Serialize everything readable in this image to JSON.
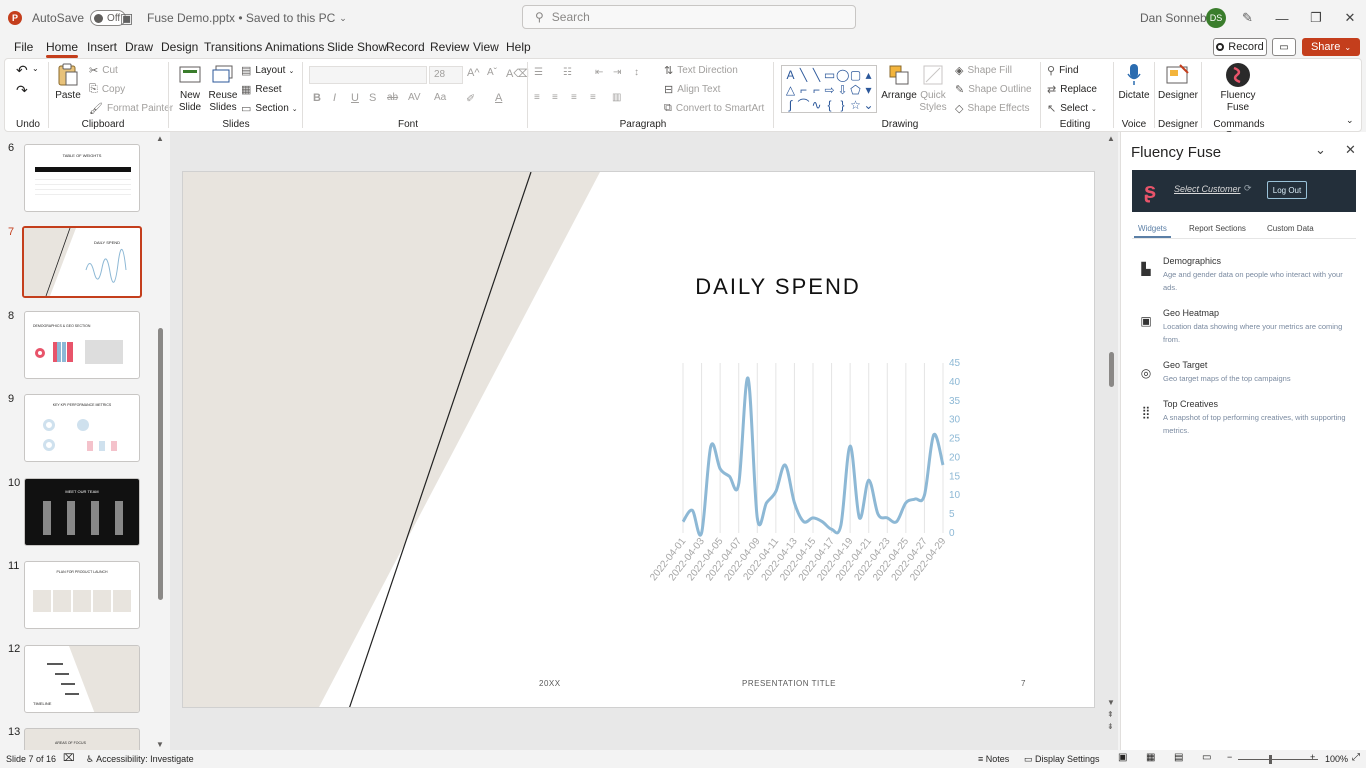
{
  "titlebar": {
    "autosave_label": "AutoSave",
    "autosave_state": "Off",
    "doc_name": "Fuse Demo.pptx • Saved to this PC",
    "search_placeholder": "Search",
    "user_name": "Dan Sonneborn",
    "user_initials": "DS",
    "app_icon": "P"
  },
  "menu": {
    "tabs": [
      "File",
      "Home",
      "Insert",
      "Draw",
      "Design",
      "Transitions",
      "Animations",
      "Slide Show",
      "Record",
      "Review",
      "View",
      "Help"
    ],
    "active_tab": "Home",
    "record_label": "Record",
    "share_label": "Share"
  },
  "ribbon": {
    "groups": [
      "Undo",
      "Clipboard",
      "Slides",
      "Font",
      "Paragraph",
      "Drawing",
      "Editing",
      "Voice",
      "Designer",
      "Commands Group"
    ],
    "clipboard": {
      "paste": "Paste",
      "cut": "Cut",
      "copy": "Copy",
      "format_painter": "Format Painter"
    },
    "slides": {
      "new_slide": "New Slide",
      "reuse_slides": "Reuse Slides",
      "layout": "Layout",
      "reset": "Reset",
      "section": "Section"
    },
    "font": {
      "size": "28"
    },
    "paragraph": {
      "text_direction": "Text Direction",
      "align_text": "Align Text",
      "convert_smartart": "Convert to SmartArt"
    },
    "drawing": {
      "arrange": "Arrange",
      "quick_styles": "Quick Styles",
      "shape_fill": "Shape Fill",
      "shape_outline": "Shape Outline",
      "shape_effects": "Shape Effects"
    },
    "editing": {
      "find": "Find",
      "replace": "Replace",
      "select": "Select"
    },
    "voice": {
      "dictate": "Dictate"
    },
    "designer": {
      "designer": "Designer"
    },
    "commands": {
      "fluency_fuse": "Fluency Fuse"
    }
  },
  "thumbnails": [
    {
      "num": "6",
      "title": "TABLE OF WEIGHTS"
    },
    {
      "num": "7",
      "title": "DAILY SPEND"
    },
    {
      "num": "8",
      "title": "DEMOGRAPHICS & GEO SECTION"
    },
    {
      "num": "9",
      "title": "KEY KPI PERFORMANCE METRICS"
    },
    {
      "num": "10",
      "title": "MEET OUR TEAM"
    },
    {
      "num": "11",
      "title": "PLAN FOR PRODUCT LAUNCH"
    },
    {
      "num": "12",
      "title": "TIMELINE"
    },
    {
      "num": "13",
      "title": "AREAS OF FOCUS"
    }
  ],
  "active_slide": "7",
  "slide": {
    "title": "DAILY SPEND",
    "footer_left": "20XX",
    "footer_center": "PRESENTATION TITLE",
    "footer_right": "7"
  },
  "chart_data": {
    "type": "line",
    "title": "",
    "xlabel": "",
    "ylabel": "",
    "ylim": [
      0,
      45
    ],
    "yticks": [
      0,
      5,
      10,
      15,
      20,
      25,
      30,
      35,
      40,
      45
    ],
    "y_axis_side": "right",
    "grid": "vertical",
    "x_tick_labels": [
      "2022-04-01",
      "2022-04-03",
      "2022-04-05",
      "2022-04-07",
      "2022-04-09",
      "2022-04-11",
      "2022-04-13",
      "2022-04-15",
      "2022-04-17",
      "2022-04-19",
      "2022-04-21",
      "2022-04-23",
      "2022-04-25",
      "2022-04-27",
      "2022-04-29"
    ],
    "x": [
      "2022-04-01",
      "2022-04-02",
      "2022-04-03",
      "2022-04-04",
      "2022-04-05",
      "2022-04-06",
      "2022-04-07",
      "2022-04-08",
      "2022-04-09",
      "2022-04-10",
      "2022-04-11",
      "2022-04-12",
      "2022-04-13",
      "2022-04-14",
      "2022-04-15",
      "2022-04-16",
      "2022-04-17",
      "2022-04-18",
      "2022-04-19",
      "2022-04-20",
      "2022-04-21",
      "2022-04-22",
      "2022-04-23",
      "2022-04-24",
      "2022-04-25",
      "2022-04-26",
      "2022-04-27",
      "2022-04-28",
      "2022-04-29"
    ],
    "series": [
      {
        "values": [
          3,
          6,
          0,
          23,
          17,
          15,
          13,
          41,
          4,
          8,
          11,
          18,
          8,
          3,
          4,
          3,
          1,
          2,
          23,
          4,
          14,
          5,
          4,
          3,
          8,
          9,
          10,
          26,
          18
        ],
        "color": "#8db8d5"
      }
    ]
  },
  "pane": {
    "title": "Fluency Fuse",
    "select_customer": "Select Customer",
    "logout": "Log Out",
    "tabs": [
      "Widgets",
      "Report Sections",
      "Custom Data"
    ],
    "widgets": [
      {
        "name": "Demographics",
        "desc": "Age and gender data on people who interact with your ads.",
        "icon": "bar-chart-icon"
      },
      {
        "name": "Geo Heatmap",
        "desc": "Location data showing where your metrics are coming from.",
        "icon": "heatmap-icon"
      },
      {
        "name": "Geo Target",
        "desc": "Geo target maps of the top campaigns",
        "icon": "target-icon"
      },
      {
        "name": "Top Creatives",
        "desc": "A snapshot of top performing creatives, with supporting metrics.",
        "icon": "grid-icon"
      }
    ]
  },
  "status": {
    "slide_of": "Slide 7 of 16",
    "accessibility": "Accessibility: Investigate",
    "notes": "Notes",
    "display_settings": "Display Settings",
    "zoom": "100%"
  }
}
